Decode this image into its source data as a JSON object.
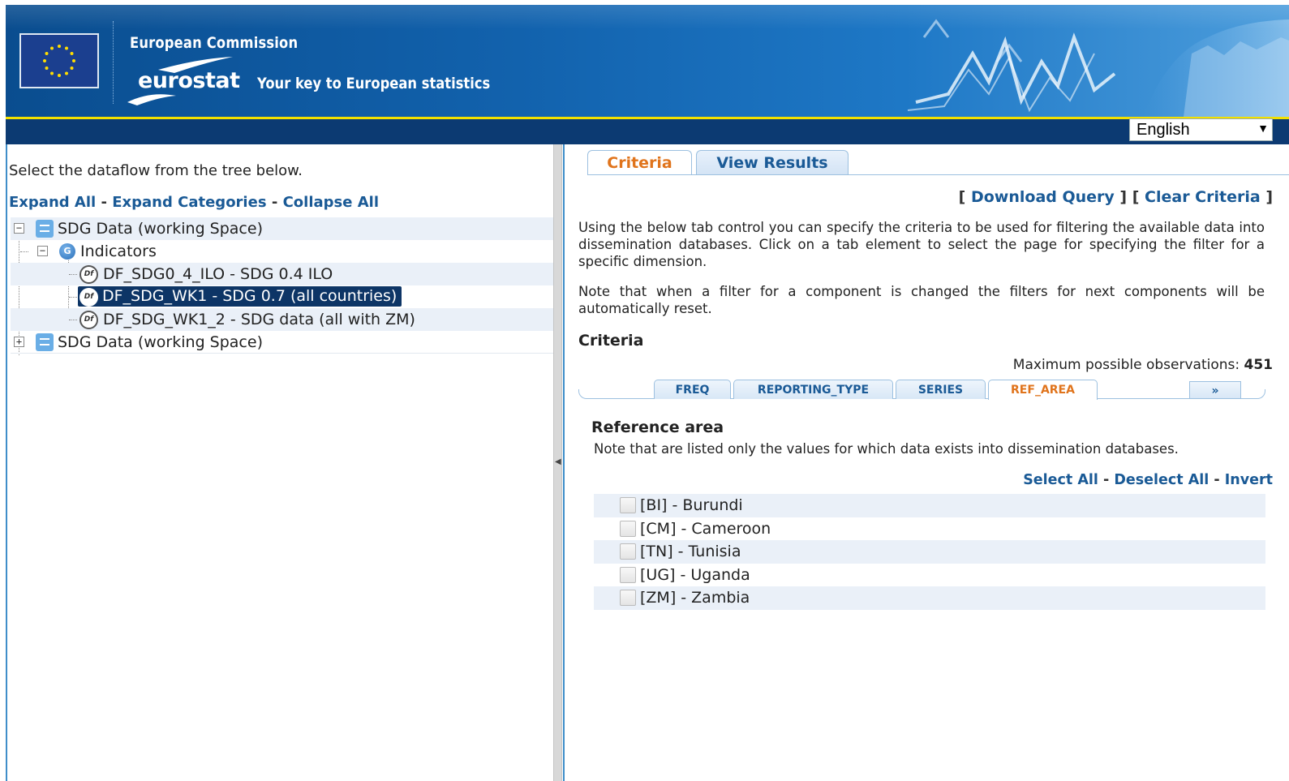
{
  "header": {
    "ec_title": "European Commission",
    "logo_text": "eurostat",
    "tagline": "Your key to European statistics",
    "language": "English"
  },
  "left_panel": {
    "intro": "Select the dataflow from the tree below.",
    "expand_all": "Expand All",
    "expand_categories": "Expand Categories",
    "collapse_all": "Collapse All",
    "separator": "-",
    "tree": {
      "root1": "SDG Data (working Space)",
      "category": "Indicators",
      "dataflows": [
        "DF_SDG0_4_ILO - SDG 0.4 ILO",
        "DF_SDG_WK1 - SDG 0.7 (all countries)",
        "DF_SDG_WK1_2 - SDG data (all with ZM)"
      ],
      "root2": "SDG Data (working Space)",
      "icon_g": "G",
      "icon_df": "Df"
    }
  },
  "right_panel": {
    "tabs": [
      "Criteria",
      "View Results"
    ],
    "query_links": {
      "open": "[",
      "download": "Download Query",
      "middle": "] [",
      "clear": "Clear Criteria",
      "close": "]"
    },
    "description1": "Using the below tab control you can specify the criteria to be used for filtering the available data into dissemination databases. Click on a tab element to select the page for specifying the filter for a specific dimension.",
    "description2": "Note that when a filter for a component is changed the filters for next components will be automatically reset.",
    "criteria_title": "Criteria",
    "max_obs_label": "Maximum possible observations:",
    "max_obs_value": "451",
    "dimension_tabs": [
      "FREQ",
      "REPORTING_TYPE",
      "SERIES",
      "REF_AREA"
    ],
    "more_tab": "»",
    "ref_area_title": "Reference area",
    "ref_area_note": "Note that are listed only the values for which data exists into dissemination databases.",
    "select_all": "Select All",
    "deselect_all": "Deselect All",
    "invert": "Invert",
    "areas": [
      "[BI] - Burundi",
      "[CM] - Cameroon",
      "[TN] - Tunisia",
      "[UG] - Uganda",
      "[ZM] - Zambia"
    ]
  },
  "colors": {
    "link": "#1a5a96",
    "active_tab": "#e0741c",
    "selected_bg": "#0d3566",
    "row_alt": "#eaf0f8",
    "nav_strip": "#0c3a72",
    "accent_yellow": "#f2e100"
  }
}
